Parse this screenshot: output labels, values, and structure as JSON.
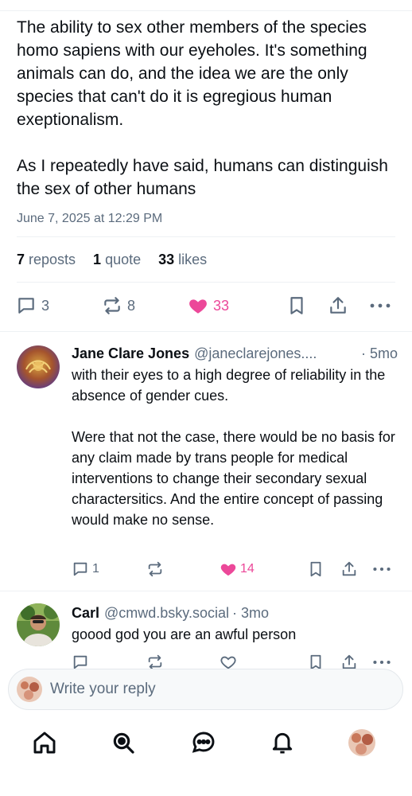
{
  "post": {
    "text": "The ability to sex other members of the species homo sapiens with our eyeholes. It's something animals can do, and the idea we are the only species that can't do it is egregious human exeptionalism.\n\nAs I repeatedly have said, humans can distinguish the sex of other humans",
    "date": "June 7, 2025 at 12:29 PM",
    "stats": {
      "reposts_count": "7",
      "reposts_label": "reposts",
      "quotes_count": "1",
      "quotes_label": "quote",
      "likes_count": "33",
      "likes_label": "likes"
    },
    "actions": {
      "replies": "3",
      "reposts": "8",
      "likes": "33",
      "liked": true
    }
  },
  "replies": [
    {
      "name": "Jane Clare Jones",
      "handle": "@janeclarejones....",
      "time": "· 5mo",
      "text": "with their eyes to a high degree of reliability in the absence of gender cues.\n\nWere that not the case, there would be no basis for any claim made by trans people for medical interventions to change their secondary sexual charactersitics. And the entire concept of passing would make no sense.",
      "reply_count": "1",
      "like_count": "14",
      "liked": true
    },
    {
      "name": "Carl",
      "handle": "@cmwd.bsky.social",
      "time": "· 3mo",
      "text": "goood god you are an awful person",
      "reply_count": "",
      "like_count": "",
      "liked": false
    }
  ],
  "composer": {
    "placeholder": "Write your reply"
  },
  "colors": {
    "like": "#ec4899",
    "muted": "#5b6b7d",
    "text": "#0b0f14"
  },
  "icons": [
    "reply-icon",
    "repost-icon",
    "heart-icon",
    "bookmark-icon",
    "share-icon",
    "more-icon",
    "home-icon",
    "search-icon",
    "chat-icon",
    "bell-icon"
  ]
}
